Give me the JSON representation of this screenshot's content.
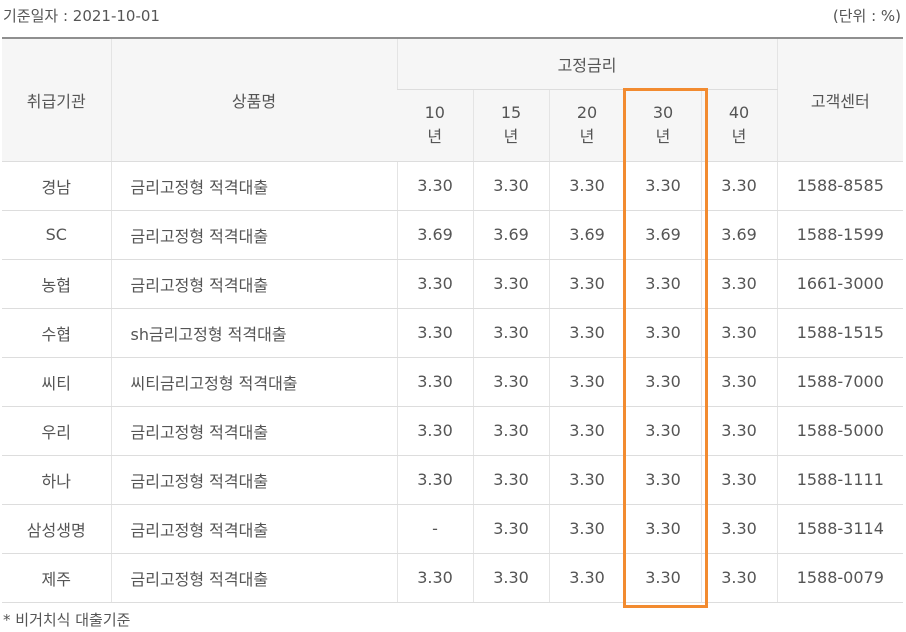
{
  "header": {
    "date_label": "기준일자 : 2021-10-01",
    "unit_label": "(단위 : %)"
  },
  "table": {
    "col_institution": "취급기관",
    "col_product": "상품명",
    "col_fixed_rate": "고정금리",
    "col_center": "고객센터",
    "terms": [
      {
        "num": "10",
        "unit": "년"
      },
      {
        "num": "15",
        "unit": "년"
      },
      {
        "num": "20",
        "unit": "년"
      },
      {
        "num": "30",
        "unit": "년"
      },
      {
        "num": "40",
        "unit": "년"
      }
    ],
    "rows": [
      {
        "institution": "경남",
        "product": "금리고정형 적격대출",
        "rates": [
          "3.30",
          "3.30",
          "3.30",
          "3.30",
          "3.30"
        ],
        "center": "1588-8585"
      },
      {
        "institution": "SC",
        "product": "금리고정형 적격대출",
        "rates": [
          "3.69",
          "3.69",
          "3.69",
          "3.69",
          "3.69"
        ],
        "center": "1588-1599"
      },
      {
        "institution": "농협",
        "product": "금리고정형 적격대출",
        "rates": [
          "3.30",
          "3.30",
          "3.30",
          "3.30",
          "3.30"
        ],
        "center": "1661-3000"
      },
      {
        "institution": "수협",
        "product": "sh금리고정형 적격대출",
        "rates": [
          "3.30",
          "3.30",
          "3.30",
          "3.30",
          "3.30"
        ],
        "center": "1588-1515"
      },
      {
        "institution": "씨티",
        "product": "씨티금리고정형 적격대출",
        "rates": [
          "3.30",
          "3.30",
          "3.30",
          "3.30",
          "3.30"
        ],
        "center": "1588-7000"
      },
      {
        "institution": "우리",
        "product": "금리고정형 적격대출",
        "rates": [
          "3.30",
          "3.30",
          "3.30",
          "3.30",
          "3.30"
        ],
        "center": "1588-5000"
      },
      {
        "institution": "하나",
        "product": "금리고정형 적격대출",
        "rates": [
          "3.30",
          "3.30",
          "3.30",
          "3.30",
          "3.30"
        ],
        "center": "1588-1111"
      },
      {
        "institution": "삼성생명",
        "product": "금리고정형 적격대출",
        "rates": [
          "-",
          "3.30",
          "3.30",
          "3.30",
          "3.30"
        ],
        "center": "1588-3114"
      },
      {
        "institution": "제주",
        "product": "금리고정형 적격대출",
        "rates": [
          "3.30",
          "3.30",
          "3.30",
          "3.30",
          "3.30"
        ],
        "center": "1588-0079"
      }
    ]
  },
  "footnote": "* 비거치식 대출기준",
  "colors": {
    "highlight": "#f28b30",
    "header_bg": "#f6f6f6",
    "text": "#555555"
  }
}
